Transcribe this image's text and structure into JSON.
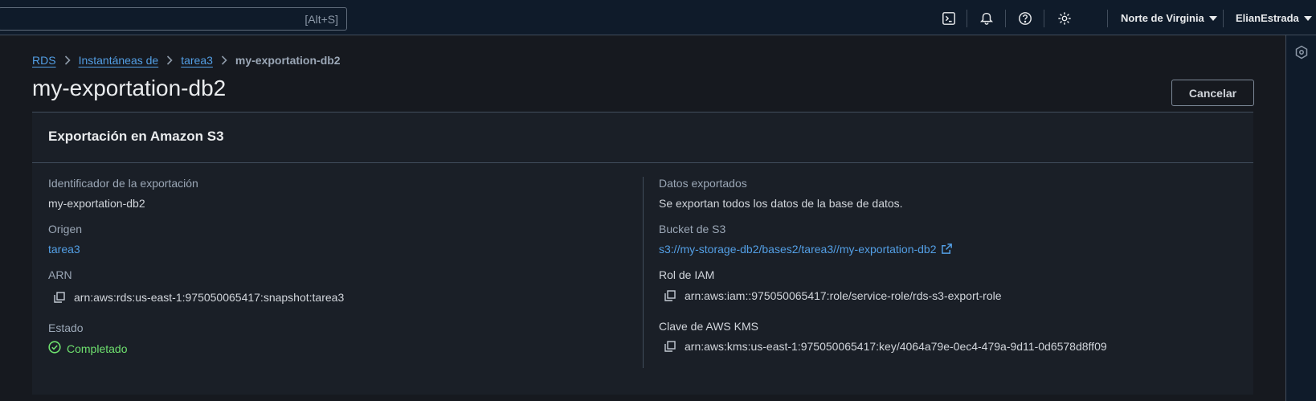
{
  "topbar": {
    "search_shortcut": "[Alt+S]",
    "region": "Norte de Virginia",
    "user": "ElianEstrada"
  },
  "breadcrumb": {
    "items": [
      "RDS",
      "Instantáneas de",
      "tarea3"
    ],
    "current": "my-exportation-db2"
  },
  "page": {
    "title": "my-exportation-db2",
    "cancel_label": "Cancelar"
  },
  "panel": {
    "title": "Exportación en Amazon S3",
    "left": {
      "export_id_label": "Identificador de la exportación",
      "export_id_value": "my-exportation-db2",
      "origin_label": "Origen",
      "origin_value": "tarea3",
      "arn_label": "ARN",
      "arn_value": "arn:aws:rds:us-east-1:975050065417:snapshot:tarea3",
      "status_label": "Estado",
      "status_value": "Completado"
    },
    "right": {
      "exported_label": "Datos exportados",
      "exported_value": "Se exportan todos los datos de la base de datos.",
      "bucket_label": "Bucket de S3",
      "bucket_value": "s3://my-storage-db2/bases2/tarea3//my-exportation-db2",
      "iam_label": "Rol de IAM",
      "iam_value": "arn:aws:iam::975050065417:role/service-role/rds-s3-export-role",
      "kms_label": "Clave de AWS KMS",
      "kms_value": "arn:aws:kms:us-east-1:975050065417:key/4064a79e-0ec4-479a-9d11-0d6578d8ff09"
    }
  },
  "colors": {
    "link": "#539fe5",
    "success": "#6ee06e",
    "background": "#16191f",
    "topbar": "#0f1b2a"
  }
}
